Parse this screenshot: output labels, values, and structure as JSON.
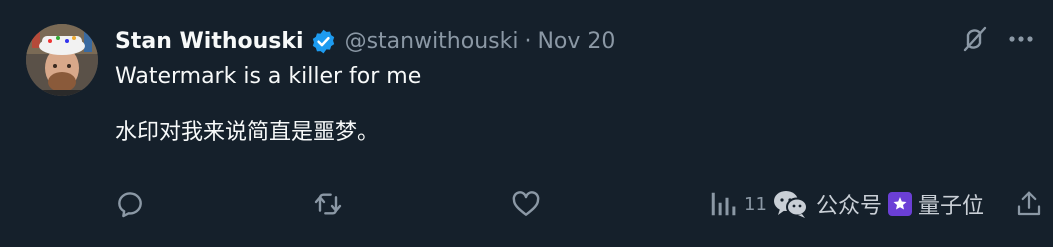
{
  "author": {
    "name": "Stan Withouski",
    "handle": "@stanwithouski",
    "separator": "·",
    "date": "Nov 20"
  },
  "tweet": {
    "text_en": "Watermark is a killer for me",
    "text_zh": "水印对我来说简直是噩梦。"
  },
  "actions": {
    "views_count": "11"
  },
  "watermark": {
    "text_1": "公众号",
    "text_2": "量子位"
  },
  "icons": {
    "verified": "verified-badge-icon",
    "grok": "grok-icon",
    "more": "more-icon",
    "reply": "reply-icon",
    "retweet": "retweet-icon",
    "like": "like-icon",
    "views": "views-icon",
    "share": "share-icon",
    "wechat": "wechat-icon"
  },
  "colors": {
    "background": "#15202b",
    "text": "#f7f9f9",
    "muted": "#8b98a5",
    "verified": "#1d9bf0"
  }
}
